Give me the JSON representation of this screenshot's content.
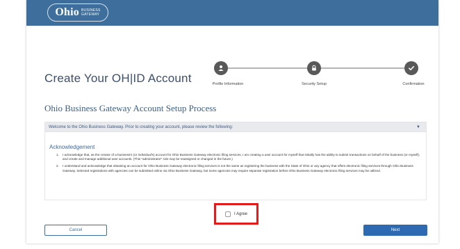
{
  "header": {
    "logo_ohio": "Ohio",
    "logo_sub_1": "BUSINESS",
    "logo_sub_2": "GATEWAY"
  },
  "page_title": "Create Your OH|ID Account",
  "steps": [
    {
      "label": "Profile Information",
      "icon": "person-icon"
    },
    {
      "label": "Security Setup",
      "icon": "lock-icon"
    },
    {
      "label": "Confirmation",
      "icon": "check-icon"
    }
  ],
  "section_title": "Ohio Business Gateway Account Setup Process",
  "accordion": {
    "header": "Welcome to the Ohio Business Gateway. Prior to creating your account, please review the following:",
    "caret": "▼"
  },
  "acknowledgement": {
    "title": "Acknowledgement",
    "items": [
      {
        "num": "1.",
        "text": "I acknowledge that, as the creator of a business's (or individual's) account for Ohio Business Gateway electronic filing services, I am creating a user account for myself that initially has the ability to submit transactions on behalf of the business (or myself), and create and manage additional user accounts. (This \"administrator\" role may be reassigned or changed in the future.)"
      },
      {
        "num": "2.",
        "text": "I understand and acknowledge that obtaining an account for Ohio Business Gateway electronic filing services is not the same as registering the business with the State of Ohio or any agency that offers electronic filing services through Ohio Business Gateway. Selected registrations with agencies can be submitted online via Ohio Business Gateway, but some agencies may require separate registration before Ohio Business Gateway electronic filing services may be utilized."
      }
    ]
  },
  "agree": {
    "label": "I Agree",
    "checked": false
  },
  "buttons": {
    "cancel": "Cancel",
    "next": "Next"
  },
  "colors": {
    "header": "#3e6e9c",
    "primary": "#2e6ab1",
    "highlight": "#e31b1b",
    "step": "#595959"
  }
}
